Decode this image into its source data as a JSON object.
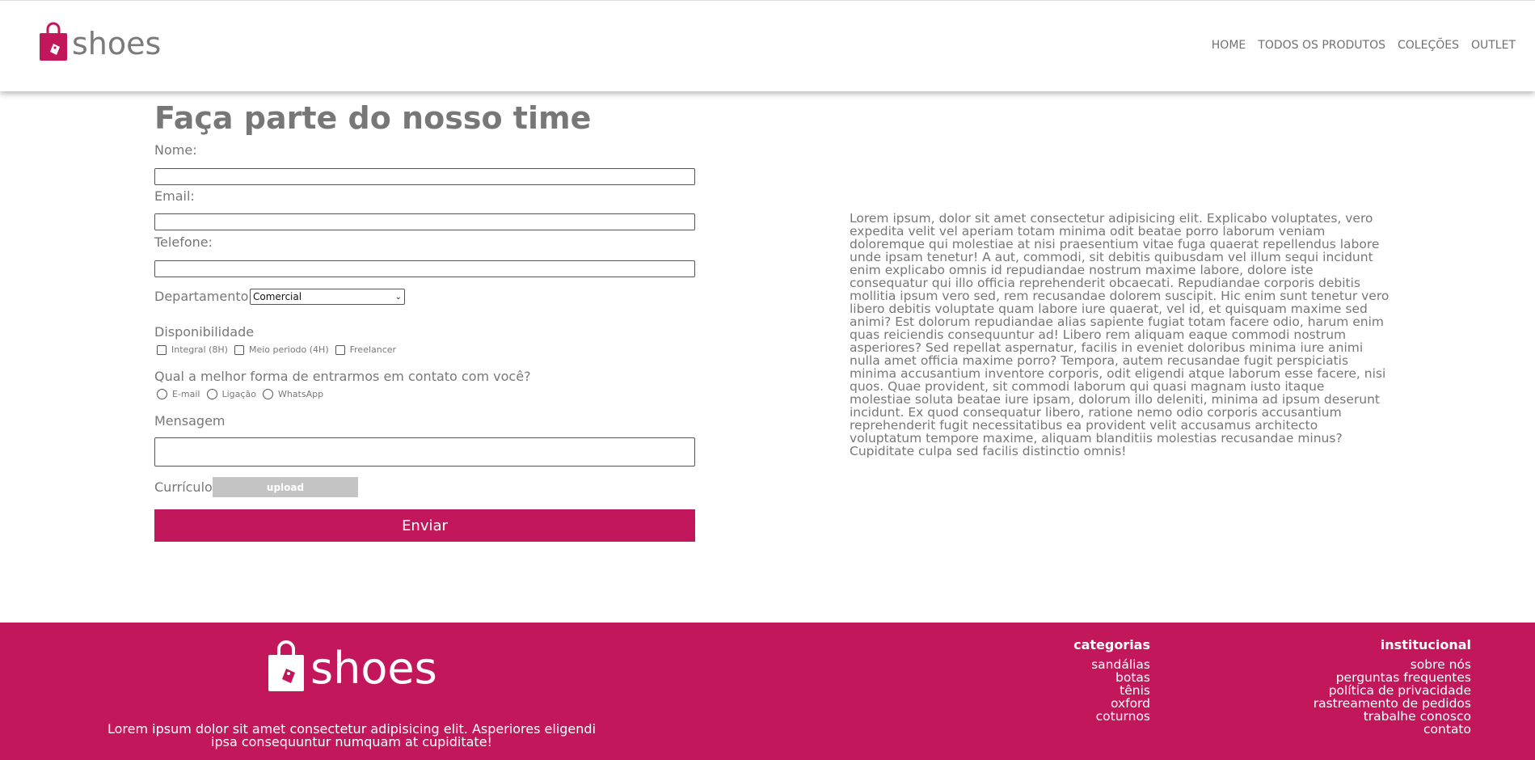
{
  "brand": {
    "name": "shoes",
    "accent_color": "#c2185b"
  },
  "header": {
    "logo_text": "shoes",
    "nav": [
      "HOME",
      "TODOS OS PRODUTOS",
      "COLEÇÕES",
      "OUTLET"
    ]
  },
  "form": {
    "title": "Faça parte do nosso time",
    "name_label": "Nome:",
    "email_label": "Email:",
    "phone_label": "Telefone:",
    "department_label": "Departamento:",
    "department_value": "Comercial",
    "availability_label": "Disponibilidade",
    "availability_options": [
      "Integral (8H)",
      "Meio periodo (4H)",
      "Freelancer"
    ],
    "contact_label": "Qual a melhor forma de entrarmos em contato com você?",
    "contact_options": [
      "E-mail",
      "Ligação",
      "WhatsApp"
    ],
    "message_label": "Mensagem",
    "resume_label": "Currículo",
    "upload_label": "upload",
    "submit_label": "Enviar"
  },
  "side_text": "Lorem ipsum, dolor sit amet consectetur adipisicing elit. Explicabo voluptates, vero expedita velit vel aperiam totam minima odit beatae porro laborum veniam doloremque qui molestiae at nisi praesentium vitae fuga quaerat repellendus labore unde ipsam tenetur! A aut, commodi, sit debitis quibusdam vel illum sequi incidunt enim explicabo omnis id repudiandae nostrum maxime labore, dolore iste consequatur qui illo officia reprehenderit obcaecati. Repudiandae corporis debitis mollitia ipsum vero sed, rem recusandae dolorem suscipit. Hic enim sunt tenetur vero libero debitis voluptate quam labore iure quaerat, vel id, et quisquam maxime sed animi? Est dolorum repudiandae alias sapiente fugiat totam facere odio, harum enim quas reiciendis consequuntur ad! Libero rem aliquam eaque commodi nostrum asperiores? Sed repellat aspernatur, facilis in eveniet doloribus minima iure animi nulla amet officia maxime porro? Tempora, autem recusandae fugit perspiciatis minima accusantium inventore corporis, odit eligendi atque laborum esse facere, nisi quos. Quae provident, sit commodi laborum qui quasi magnam iusto itaque molestiae soluta beatae iure ipsam, dolorum illo deleniti, minima ad ipsum deserunt incidunt. Ex quod consequatur libero, ratione nemo odio corporis accusantium reprehenderit fugit necessitatibus ea provident velit accusamus architecto voluptatum tempore maxime, aliquam blanditiis molestias recusandae minus? Cupiditate culpa sed facilis distinctio omnis!",
  "footer": {
    "logo_text": "shoes",
    "description": "Lorem ipsum dolor sit amet consectetur adipisicing elit. Asperiores eligendi ipsa consequuntur numquam at cupiditate!",
    "categories": {
      "title": "categorias",
      "items": [
        "sandálias",
        "botas",
        "tênis",
        "oxford",
        "coturnos"
      ]
    },
    "institutional": {
      "title": "institucional",
      "items": [
        "sobre nós",
        "perguntas frequentes",
        "política de privacidade",
        "rastreamento de pedidos",
        "trabalhe conosco",
        "contato"
      ]
    }
  }
}
